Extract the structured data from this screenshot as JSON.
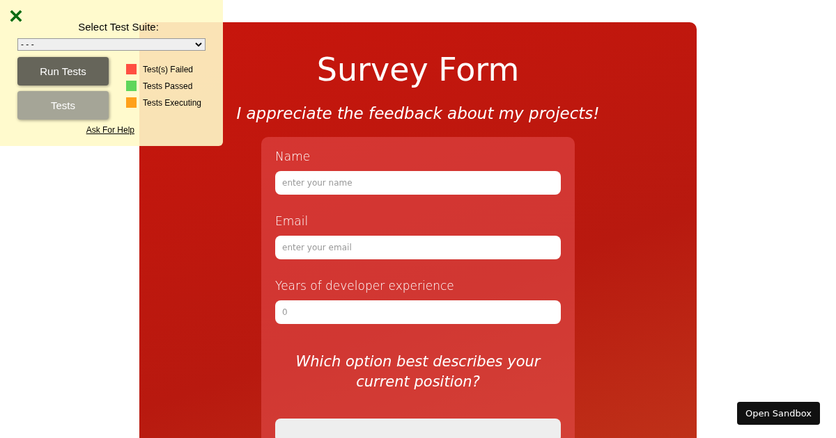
{
  "test_panel": {
    "title": "Select Test Suite:",
    "suite_select": {
      "value": "- - -"
    },
    "buttons": [
      {
        "label": "Run Tests",
        "kind": "primary"
      },
      {
        "label": "Tests",
        "kind": "secondary"
      }
    ],
    "legend": [
      {
        "label": "Test(s) Failed",
        "color": "#ff4f42"
      },
      {
        "label": "Tests Passed",
        "color": "#5fd65b"
      },
      {
        "label": "Tests Executing",
        "color": "#ffa11a"
      }
    ],
    "help_link": "Ask For Help"
  },
  "survey": {
    "title": "Survey Form",
    "subtitle": "I appreciate the feedback about my projects!",
    "fields": [
      {
        "label": "Name",
        "placeholder": "enter your name"
      },
      {
        "label": "Email",
        "placeholder": "enter your email"
      },
      {
        "label": "Years of developer experience",
        "placeholder": "0"
      }
    ],
    "question": "Which option best describes your current position?"
  },
  "sandbox_button": "Open Sandbox"
}
